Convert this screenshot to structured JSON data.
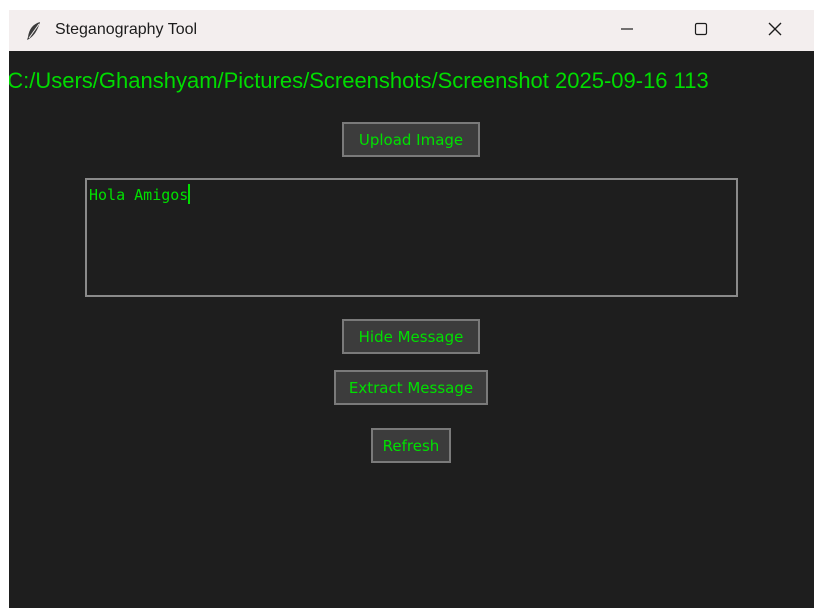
{
  "window": {
    "title": "Steganography Tool",
    "app_icon": "feather-icon",
    "controls": {
      "minimize_icon": "minimize-icon",
      "maximize_icon": "maximize-icon",
      "close_icon": "close-icon"
    }
  },
  "main": {
    "file_path": ": C:/Users/Ghanshyam/Pictures/Screenshots/Screenshot 2025-09-16 113",
    "upload_button": "Upload Image",
    "message_value": "Hola Amigos",
    "hide_button": "Hide Message",
    "extract_button": "Extract Message",
    "refresh_button": "Refresh"
  },
  "colors": {
    "background": "#1e1e1e",
    "text_accent": "#00e000",
    "button_bg": "#3c3c3c",
    "titlebar": "#f3eeee"
  }
}
